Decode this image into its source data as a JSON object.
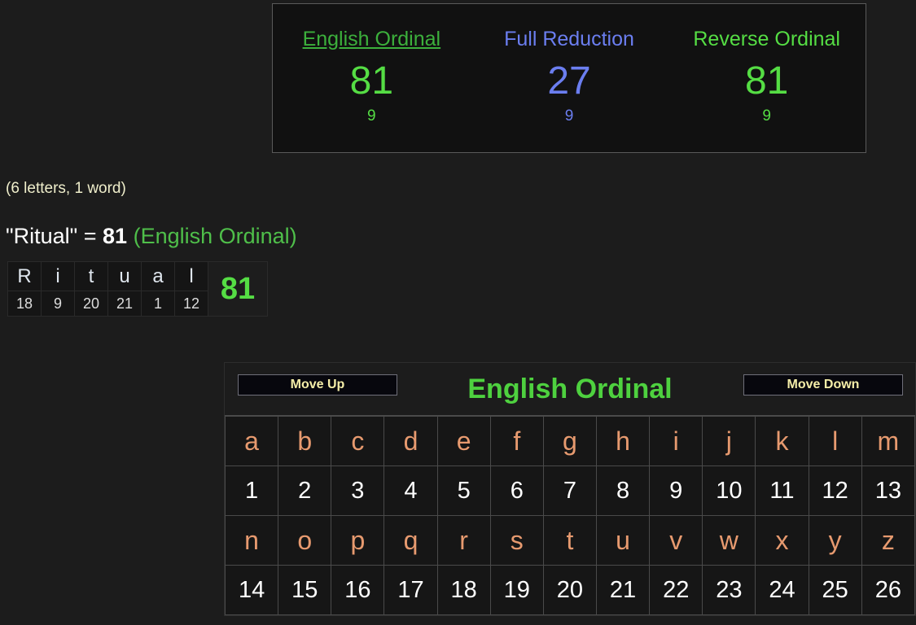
{
  "colors": {
    "page_background": "#1c1c1c",
    "green_cipher": "#3cb03c",
    "green_value": "#55dd44",
    "blue_cipher": "#6b7ef0",
    "alphabet_letter": "#e79a6f",
    "button_text": "#f5eea8",
    "cream_text": "#efeecb"
  },
  "cipher_summary": {
    "ciphers": [
      {
        "name": "English Ordinal",
        "value": "81",
        "reduced": "9",
        "color": "green",
        "is_link": true
      },
      {
        "name": "Full Reduction",
        "value": "27",
        "reduced": "9",
        "color": "blue",
        "is_link": false
      },
      {
        "name": "Reverse Ordinal",
        "value": "81",
        "reduced": "9",
        "color": "green",
        "is_link": false
      }
    ]
  },
  "summary": {
    "letters_count": "(6 letters, 1 word)",
    "phrase_quoted": "\"Ritual\"",
    "equals": "=",
    "total": "81",
    "cipher_tag": "(English Ordinal)"
  },
  "breakdown": {
    "letters": [
      "R",
      "i",
      "t",
      "u",
      "a",
      "l"
    ],
    "values": [
      "18",
      "9",
      "20",
      "21",
      "1",
      "12"
    ],
    "total": "81"
  },
  "alphabet_table": {
    "title": "English Ordinal",
    "move_up_label": "Move Up",
    "move_down_label": "Move Down",
    "row1_letters": [
      "a",
      "b",
      "c",
      "d",
      "e",
      "f",
      "g",
      "h",
      "i",
      "j",
      "k",
      "l",
      "m"
    ],
    "row1_values": [
      "1",
      "2",
      "3",
      "4",
      "5",
      "6",
      "7",
      "8",
      "9",
      "10",
      "11",
      "12",
      "13"
    ],
    "row2_letters": [
      "n",
      "o",
      "p",
      "q",
      "r",
      "s",
      "t",
      "u",
      "v",
      "w",
      "x",
      "y",
      "z"
    ],
    "row2_values": [
      "14",
      "15",
      "16",
      "17",
      "18",
      "19",
      "20",
      "21",
      "22",
      "23",
      "24",
      "25",
      "26"
    ]
  }
}
